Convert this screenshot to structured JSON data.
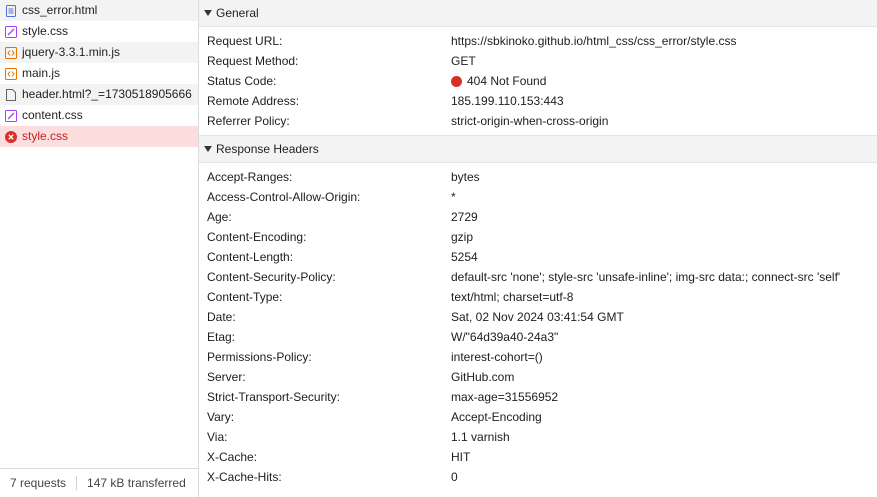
{
  "files": [
    {
      "name": "css_error.html",
      "icon": "document-icon",
      "icon_color": "#5a6fd6",
      "state": "alt"
    },
    {
      "name": "style.css",
      "icon": "stylesheet-icon",
      "icon_color": "#a142f4",
      "state": "normal"
    },
    {
      "name": "jquery-3.3.1.min.js",
      "icon": "script-icon",
      "icon_color": "#e37400",
      "state": "alt"
    },
    {
      "name": "main.js",
      "icon": "script-icon",
      "icon_color": "#e37400",
      "state": "normal"
    },
    {
      "name": "header.html?_=1730518905666",
      "icon": "file-icon",
      "icon_color": "#5f6368",
      "state": "alt"
    },
    {
      "name": "content.css",
      "icon": "stylesheet-icon",
      "icon_color": "#a142f4",
      "state": "normal"
    },
    {
      "name": "style.css",
      "icon": "error-icon",
      "icon_color": "#d93025",
      "state": "selected"
    }
  ],
  "footer": {
    "requests": "7 requests",
    "transferred": "147 kB transferred"
  },
  "general": {
    "title": "General",
    "rows": [
      {
        "key": "Request URL:",
        "value": "https://sbkinoko.github.io/html_css/css_error/style.css"
      },
      {
        "key": "Request Method:",
        "value": "GET"
      },
      {
        "key": "Status Code:",
        "value": "404 Not Found",
        "status_color": "#d93025"
      },
      {
        "key": "Remote Address:",
        "value": "185.199.110.153:443"
      },
      {
        "key": "Referrer Policy:",
        "value": "strict-origin-when-cross-origin"
      }
    ]
  },
  "response_headers": {
    "title": "Response Headers",
    "rows": [
      {
        "key": "Accept-Ranges:",
        "value": "bytes"
      },
      {
        "key": "Access-Control-Allow-Origin:",
        "value": "*"
      },
      {
        "key": "Age:",
        "value": "2729"
      },
      {
        "key": "Content-Encoding:",
        "value": "gzip"
      },
      {
        "key": "Content-Length:",
        "value": "5254"
      },
      {
        "key": "Content-Security-Policy:",
        "value": "default-src 'none'; style-src 'unsafe-inline'; img-src data:; connect-src 'self'"
      },
      {
        "key": "Content-Type:",
        "value": "text/html; charset=utf-8"
      },
      {
        "key": "Date:",
        "value": "Sat, 02 Nov 2024 03:41:54 GMT"
      },
      {
        "key": "Etag:",
        "value": "W/\"64d39a40-24a3\""
      },
      {
        "key": "Permissions-Policy:",
        "value": "interest-cohort=()"
      },
      {
        "key": "Server:",
        "value": "GitHub.com"
      },
      {
        "key": "Strict-Transport-Security:",
        "value": "max-age=31556952"
      },
      {
        "key": "Vary:",
        "value": "Accept-Encoding"
      },
      {
        "key": "Via:",
        "value": "1.1 varnish"
      },
      {
        "key": "X-Cache:",
        "value": "HIT"
      },
      {
        "key": "X-Cache-Hits:",
        "value": "0"
      }
    ]
  }
}
